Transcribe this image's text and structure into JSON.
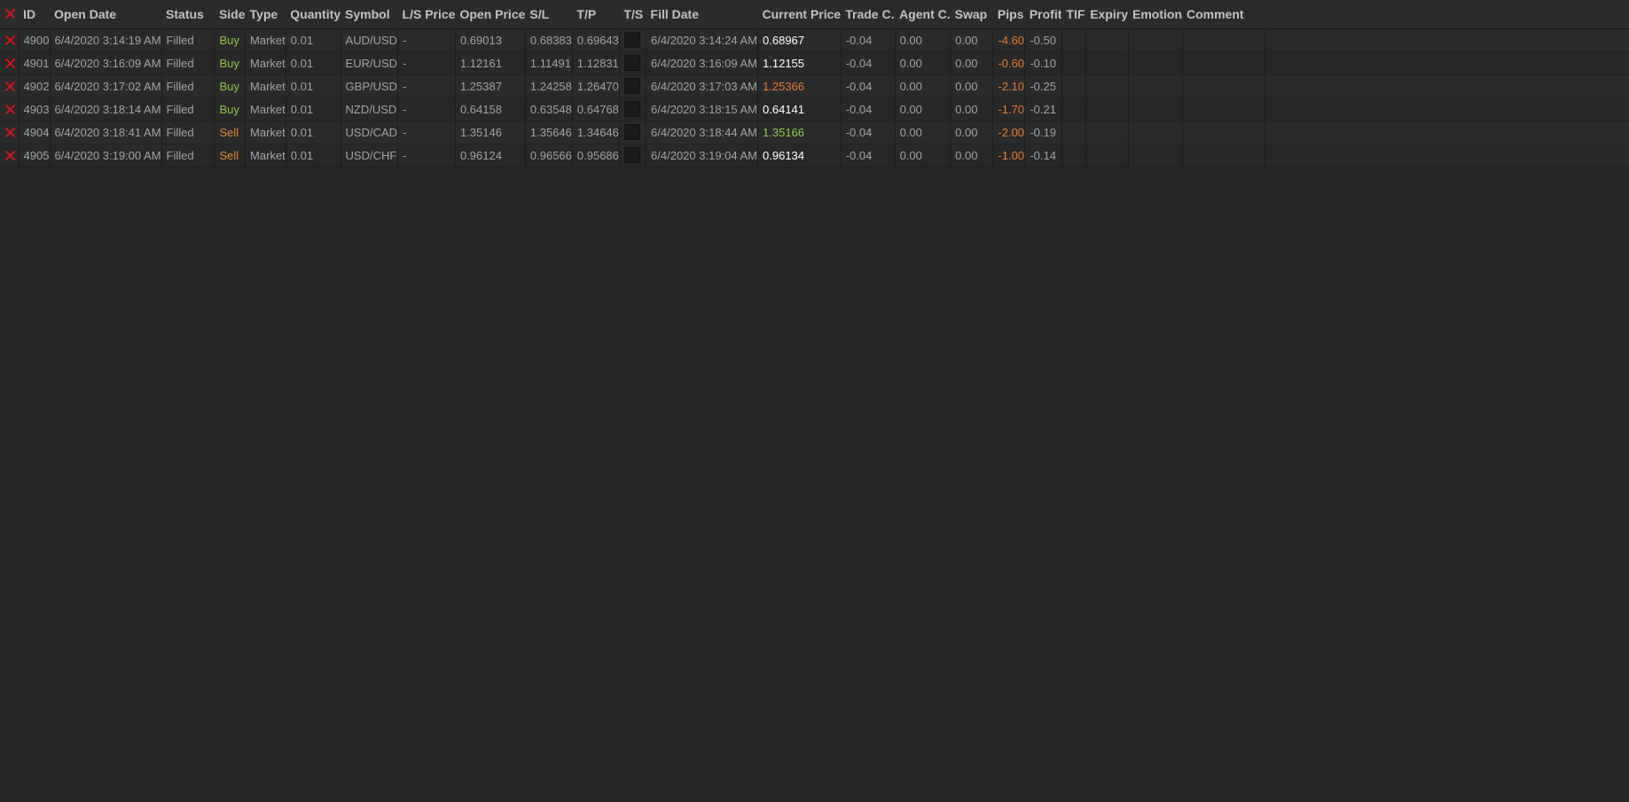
{
  "colors": {
    "background": "#252525",
    "header_text": "#c2c2c2",
    "cell_text": "#a4a4a4",
    "close_red": "#e0141d",
    "buy_green": "#92c83e",
    "sell_orange": "#e08a2e",
    "price_white": "#ffffff",
    "price_orange": "#e57c33",
    "price_green": "#8fd14f",
    "negative_orange": "#e57c33"
  },
  "header": {
    "close_icon": "close-all-icon",
    "columns": [
      "ID",
      "Open Date",
      "Status",
      "Side",
      "Type",
      "Quantity",
      "Symbol",
      "L/S Price",
      "Open Price",
      "S/L",
      "T/P",
      "T/S",
      "Fill Date",
      "Current Price",
      "Trade C.",
      "Agent C.",
      "Swap",
      "Pips",
      "Profit",
      "TIF",
      "Expiry",
      "Emotion",
      "Comment"
    ]
  },
  "rows": [
    {
      "id": "4900",
      "open_date": "6/4/2020 3:14:19 AM",
      "status": "Filled",
      "side": "Buy",
      "type": "Market",
      "quantity": "0.01",
      "symbol": "AUD/USD",
      "ls_price": "-",
      "open_price": "0.69013",
      "sl": "0.68383",
      "tp": "0.69643",
      "fill_date": "6/4/2020 3:14:24 AM",
      "current_price": "0.68967",
      "current_price_color": "#ffffff",
      "trade_c": "-0.04",
      "agent_c": "0.00",
      "swap": "0.00",
      "pips": "-4.60",
      "profit": "-0.50",
      "tif": "",
      "expiry": "",
      "emotion": "",
      "comment": ""
    },
    {
      "id": "4901",
      "open_date": "6/4/2020 3:16:09 AM",
      "status": "Filled",
      "side": "Buy",
      "type": "Market",
      "quantity": "0.01",
      "symbol": "EUR/USD",
      "ls_price": "-",
      "open_price": "1.12161",
      "sl": "1.11491",
      "tp": "1.12831",
      "fill_date": "6/4/2020 3:16:09 AM",
      "current_price": "1.12155",
      "current_price_color": "#ffffff",
      "trade_c": "-0.04",
      "agent_c": "0.00",
      "swap": "0.00",
      "pips": "-0.60",
      "profit": "-0.10",
      "tif": "",
      "expiry": "",
      "emotion": "",
      "comment": ""
    },
    {
      "id": "4902",
      "open_date": "6/4/2020 3:17:02 AM",
      "status": "Filled",
      "side": "Buy",
      "type": "Market",
      "quantity": "0.01",
      "symbol": "GBP/USD",
      "ls_price": "-",
      "open_price": "1.25387",
      "sl": "1.24258",
      "tp": "1.26470",
      "fill_date": "6/4/2020 3:17:03 AM",
      "current_price": "1.25366",
      "current_price_color": "#e57c33",
      "trade_c": "-0.04",
      "agent_c": "0.00",
      "swap": "0.00",
      "pips": "-2.10",
      "profit": "-0.25",
      "tif": "",
      "expiry": "",
      "emotion": "",
      "comment": ""
    },
    {
      "id": "4903",
      "open_date": "6/4/2020 3:18:14 AM",
      "status": "Filled",
      "side": "Buy",
      "type": "Market",
      "quantity": "0.01",
      "symbol": "NZD/USD",
      "ls_price": "-",
      "open_price": "0.64158",
      "sl": "0.63548",
      "tp": "0.64768",
      "fill_date": "6/4/2020 3:18:15 AM",
      "current_price": "0.64141",
      "current_price_color": "#ffffff",
      "trade_c": "-0.04",
      "agent_c": "0.00",
      "swap": "0.00",
      "pips": "-1.70",
      "profit": "-0.21",
      "tif": "",
      "expiry": "",
      "emotion": "",
      "comment": ""
    },
    {
      "id": "4904",
      "open_date": "6/4/2020 3:18:41 AM",
      "status": "Filled",
      "side": "Sell",
      "type": "Market",
      "quantity": "0.01",
      "symbol": "USD/CAD",
      "ls_price": "-",
      "open_price": "1.35146",
      "sl": "1.35646",
      "tp": "1.34646",
      "fill_date": "6/4/2020 3:18:44 AM",
      "current_price": "1.35166",
      "current_price_color": "#8fd14f",
      "trade_c": "-0.04",
      "agent_c": "0.00",
      "swap": "0.00",
      "pips": "-2.00",
      "profit": "-0.19",
      "tif": "",
      "expiry": "",
      "emotion": "",
      "comment": ""
    },
    {
      "id": "4905",
      "open_date": "6/4/2020 3:19:00 AM",
      "status": "Filled",
      "side": "Sell",
      "type": "Market",
      "quantity": "0.01",
      "symbol": "USD/CHF",
      "ls_price": "-",
      "open_price": "0.96124",
      "sl": "0.96566",
      "tp": "0.95686",
      "fill_date": "6/4/2020 3:19:04 AM",
      "current_price": "0.96134",
      "current_price_color": "#ffffff",
      "trade_c": "-0.04",
      "agent_c": "0.00",
      "swap": "0.00",
      "pips": "-1.00",
      "profit": "-0.14",
      "tif": "",
      "expiry": "",
      "emotion": "",
      "comment": ""
    }
  ]
}
